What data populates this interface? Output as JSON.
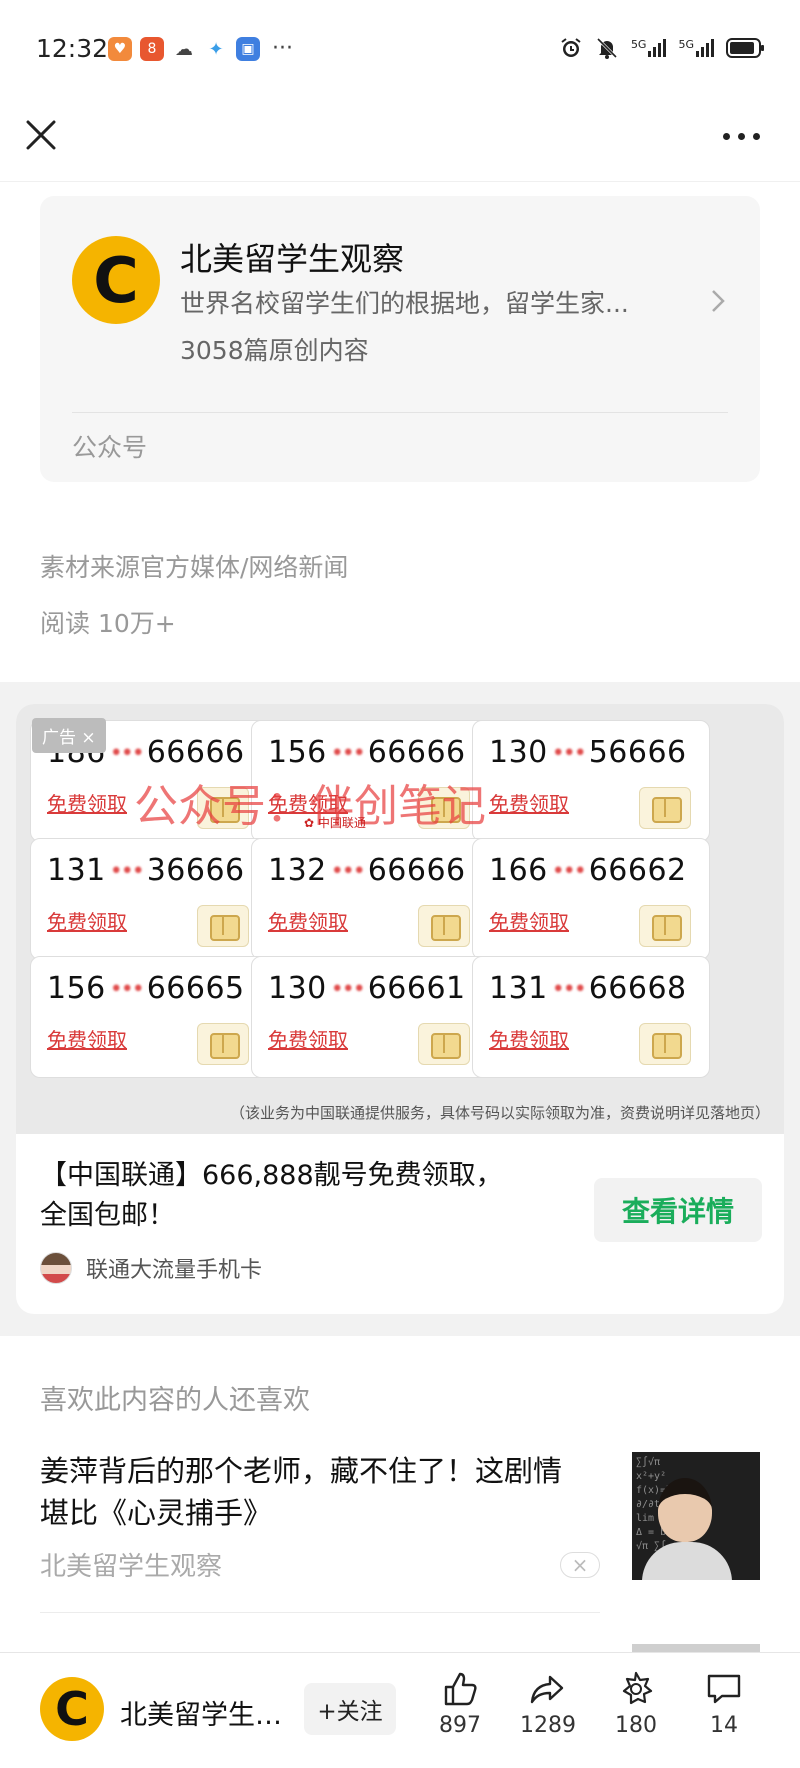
{
  "status_bar": {
    "time": "12:32",
    "app_icons": [
      "weibo-icon",
      "app-8-icon",
      "wechat-icon",
      "pinwheel-icon",
      "id-card-icon"
    ],
    "more": "···",
    "signal_1": "5G",
    "signal_2": "5G"
  },
  "account": {
    "logo_letter": "C",
    "name": "北美留学生观察",
    "description": "世界名校留学生们的根据地，留学生家...",
    "article_count": "3058篇原创内容",
    "type": "公众号"
  },
  "article": {
    "source": "素材来源官方媒体/网络新闻",
    "reads": "阅读 10万+"
  },
  "ad": {
    "tag": "广告",
    "watermark": "公众号：伴创笔记",
    "unicom_mark": "中国联通",
    "numbers": [
      {
        "prefix": "186",
        "mask": "•••",
        "suffix": "66666",
        "action": "免费领取"
      },
      {
        "prefix": "156",
        "mask": "•••",
        "suffix": "66666",
        "action": "免费领取"
      },
      {
        "prefix": "130",
        "mask": "•••",
        "suffix": "56666",
        "action": "免费领取"
      },
      {
        "prefix": "131",
        "mask": "•••",
        "suffix": "36666",
        "action": "免费领取"
      },
      {
        "prefix": "132",
        "mask": "•••",
        "suffix": "66666",
        "action": "免费领取"
      },
      {
        "prefix": "166",
        "mask": "•••",
        "suffix": "66662",
        "action": "免费领取"
      },
      {
        "prefix": "156",
        "mask": "•••",
        "suffix": "66665",
        "action": "免费领取"
      },
      {
        "prefix": "130",
        "mask": "•••",
        "suffix": "66661",
        "action": "免费领取"
      },
      {
        "prefix": "131",
        "mask": "•••",
        "suffix": "66668",
        "action": "免费领取"
      }
    ],
    "disclaimer": "（该业务为中国联通提供服务，具体号码以实际领取为准，资费说明详见落地页）",
    "title": "【中国联通】666,888靓号免费领取，全国包邮！",
    "cta": "查看详情",
    "advertiser": "联通大流量手机卡"
  },
  "related": {
    "header": "喜欢此内容的人还喜欢",
    "items": [
      {
        "title": "姜萍背后的那个老师，藏不住了！这剧情堪比《心灵捕手》",
        "source": "北美留学生观察",
        "dismiss": "×"
      }
    ]
  },
  "bottom_bar": {
    "logo_letter": "C",
    "account_name": "北美留学生观察",
    "follow": "+关注",
    "likes": "897",
    "shares": "1289",
    "favorites": "180",
    "comments": "14"
  },
  "colors": {
    "brand_yellow": "#f5b400",
    "cta_green": "#1aad5b",
    "ad_red": "#d93a3a"
  }
}
